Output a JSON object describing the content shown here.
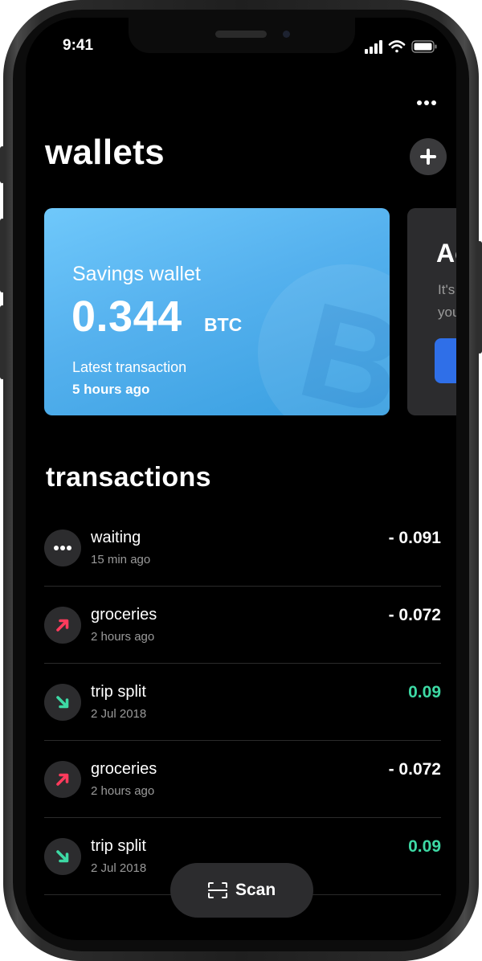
{
  "status_bar": {
    "time": "9:41"
  },
  "header": {
    "title": "wallets",
    "add_icon": "plus-icon",
    "menu_icon": "more-dots-icon"
  },
  "wallet_card": {
    "name": "Savings wallet",
    "amount": "0.344",
    "unit": "BTC",
    "latest_label": "Latest transaction",
    "latest_value": "5 hours ago",
    "watermark_icon": "bitcoin-icon"
  },
  "secondary_card": {
    "title": "Ac",
    "text_line1": "It's",
    "text_line2": "you"
  },
  "transactions": {
    "title": "transactions",
    "items": [
      {
        "label": "waiting",
        "time": "15 min ago",
        "amount": "- 0.091",
        "type": "pending",
        "icon": "more-dots-icon",
        "amount_color": "#ffffff"
      },
      {
        "label": "groceries",
        "time": "2 hours ago",
        "amount": "- 0.072",
        "type": "outgoing",
        "icon": "arrow-up-right-icon",
        "amount_color": "#ffffff"
      },
      {
        "label": "trip split",
        "time": "2 Jul 2018",
        "amount": "0.09",
        "type": "incoming",
        "icon": "arrow-down-right-icon",
        "amount_color": "#3dd9a4"
      },
      {
        "label": "groceries",
        "time": "2 hours ago",
        "amount": "- 0.072",
        "type": "outgoing",
        "icon": "arrow-up-right-icon",
        "amount_color": "#ffffff"
      },
      {
        "label": "trip split",
        "time": "2 Jul 2018",
        "amount": "0.09",
        "type": "incoming",
        "icon": "arrow-down-right-icon",
        "amount_color": "#3dd9a4"
      }
    ]
  },
  "scan_button": {
    "label": "Scan",
    "icon": "scan-icon"
  },
  "colors": {
    "outgoing": "#ff3b5c",
    "incoming": "#3dd9a4",
    "card_blue": "#55b1ee",
    "cta_blue": "#2f6fe8"
  }
}
